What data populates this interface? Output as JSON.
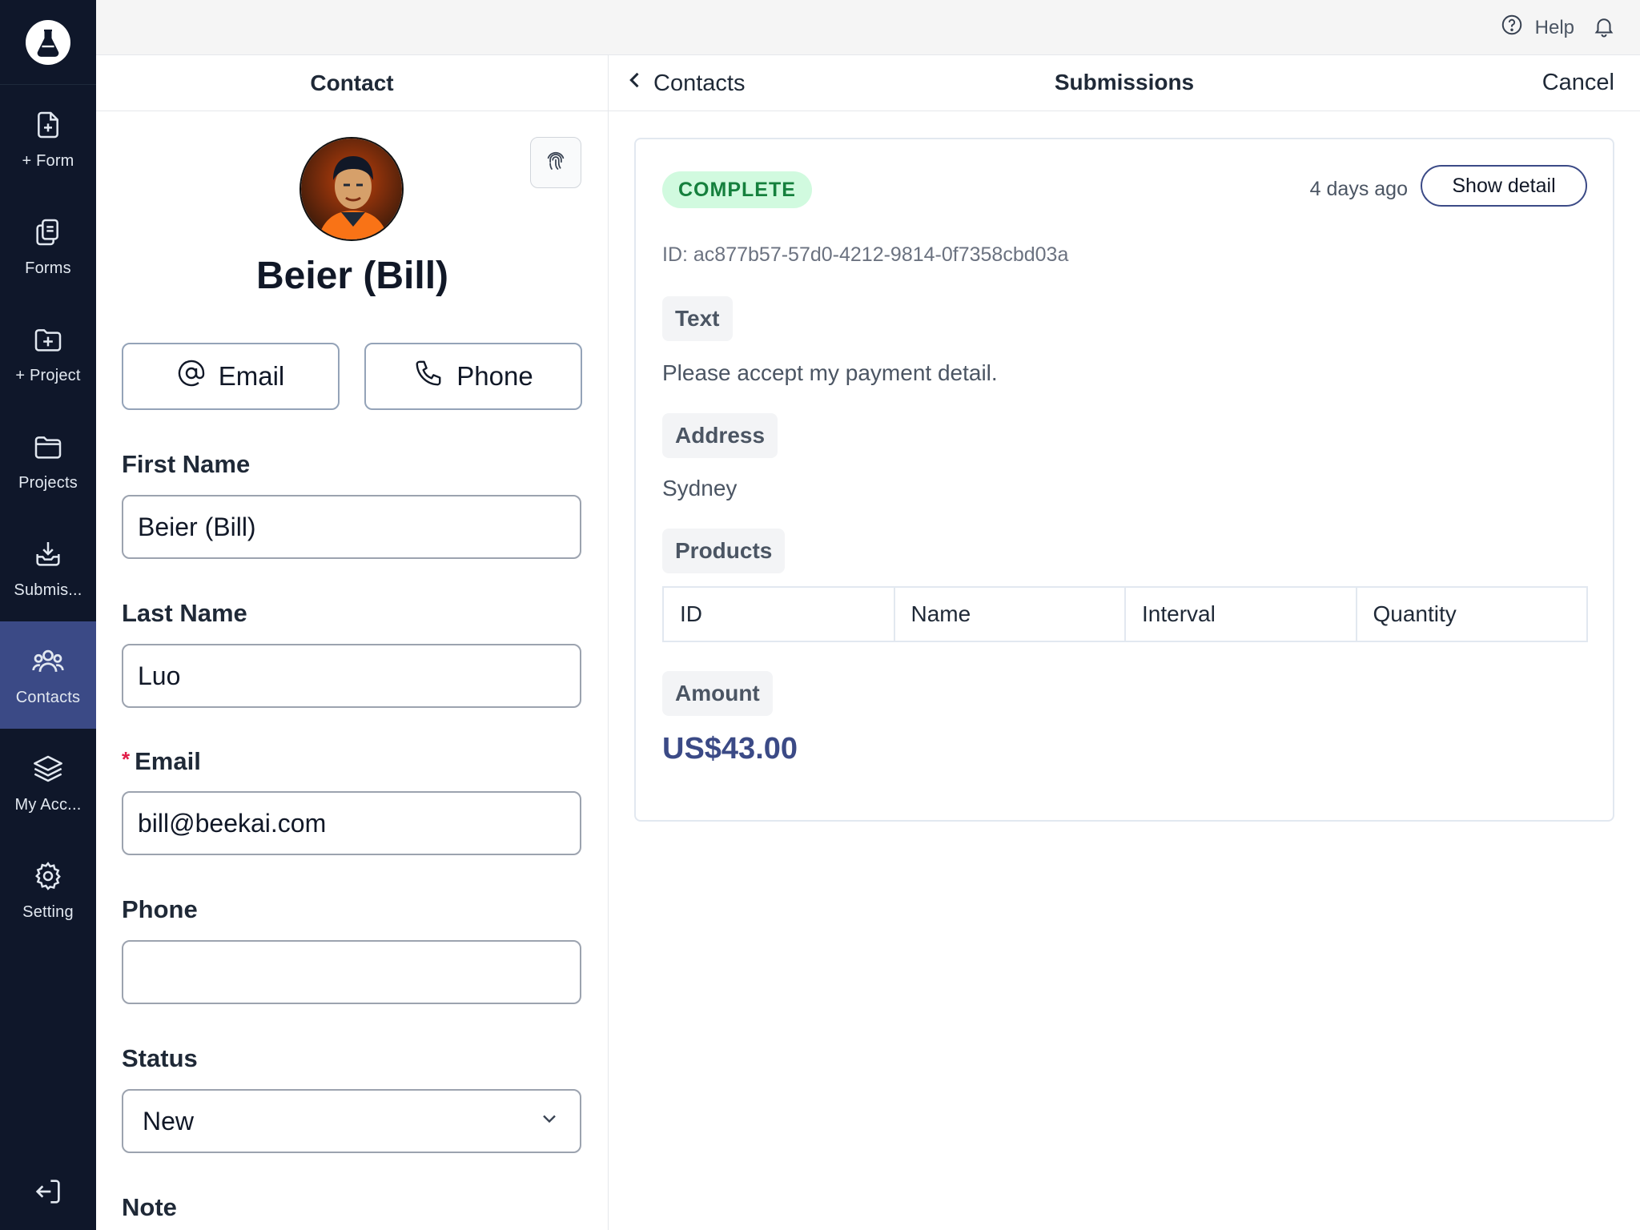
{
  "sidebar": {
    "items": [
      {
        "label": "+ Form",
        "icon": "file-plus-icon"
      },
      {
        "label": "Forms",
        "icon": "copy-icon"
      },
      {
        "label": "+ Project",
        "icon": "folder-plus-icon"
      },
      {
        "label": "Projects",
        "icon": "folder-icon"
      },
      {
        "label": "Submis...",
        "icon": "inbox-download-icon"
      },
      {
        "label": "Contacts",
        "icon": "users-icon",
        "active": true
      },
      {
        "label": "My Acc...",
        "icon": "layers-icon"
      },
      {
        "label": "Setting",
        "icon": "gear-icon"
      }
    ]
  },
  "topbar": {
    "help_label": "Help"
  },
  "contact_panel": {
    "title": "Contact",
    "name": "Beier (Bill)",
    "email_button": "Email",
    "phone_button": "Phone",
    "first_name_label": "First Name",
    "first_name_value": "Beier (Bill)",
    "last_name_label": "Last Name",
    "last_name_value": "Luo",
    "email_required_mark": "*",
    "email_label": "Email",
    "email_value": "bill@beekai.com",
    "phone_label": "Phone",
    "phone_value": "",
    "status_label": "Status",
    "status_value": "New",
    "note_label": "Note"
  },
  "submissions_panel": {
    "back_label": "Contacts",
    "title": "Submissions",
    "cancel_label": "Cancel",
    "card": {
      "status_badge": "COMPLETE",
      "time_ago": "4 days ago",
      "show_detail": "Show detail",
      "id_text": "ID: ac877b57-57d0-4212-9814-0f7358cbd03a",
      "text_label": "Text",
      "text_value": "Please accept my payment detail.",
      "address_label": "Address",
      "address_value": "Sydney",
      "products_label": "Products",
      "products_columns": [
        "ID",
        "Name",
        "Interval",
        "Quantity"
      ],
      "amount_label": "Amount",
      "amount_value": "US$43.00"
    }
  },
  "colors": {
    "sidebar_bg": "#0f172a",
    "active_nav": "#3b4a86",
    "accent": "#3b4a86",
    "badge_bg": "#d1fadf",
    "badge_text": "#15803d",
    "required": "#e11d48"
  }
}
